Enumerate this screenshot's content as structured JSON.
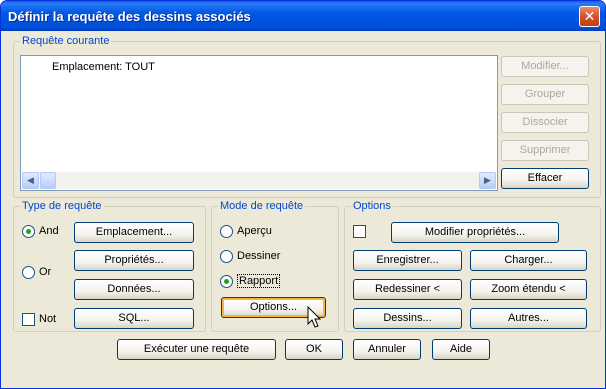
{
  "window": {
    "title": "Définir la requête des dessins associés",
    "close_glyph": "✕"
  },
  "current_request": {
    "legend": "Requête courante",
    "items": [
      "Emplacement: TOUT"
    ],
    "buttons": {
      "modify": "Modifier...",
      "group": "Grouper",
      "dissociate": "Dissocier",
      "delete": "Supprimer",
      "clear": "Effacer"
    }
  },
  "request_type": {
    "legend": "Type de requête",
    "options": {
      "and": "And",
      "or": "Or",
      "not": "Not"
    },
    "selected": "and",
    "not_checked": false,
    "buttons": {
      "location": "Emplacement...",
      "properties": "Propriétés...",
      "data": "Données...",
      "sql": "SQL..."
    }
  },
  "request_mode": {
    "legend": "Mode de requête",
    "options": {
      "preview": "Aperçu",
      "draw": "Dessiner",
      "report": "Rapport"
    },
    "selected": "report",
    "button_options": "Options..."
  },
  "options": {
    "legend": "Options",
    "checkbox_checked": false,
    "buttons": {
      "modify_properties": "Modifier propriétés...",
      "save": "Enregistrer...",
      "load": "Charger...",
      "redraw": "Redessiner <",
      "zoom_extents": "Zoom étendu <",
      "drawings": "Dessins...",
      "others": "Autres..."
    }
  },
  "footer": {
    "execute": "Exécuter une requête",
    "ok": "OK",
    "cancel": "Annuler",
    "help": "Aide"
  }
}
